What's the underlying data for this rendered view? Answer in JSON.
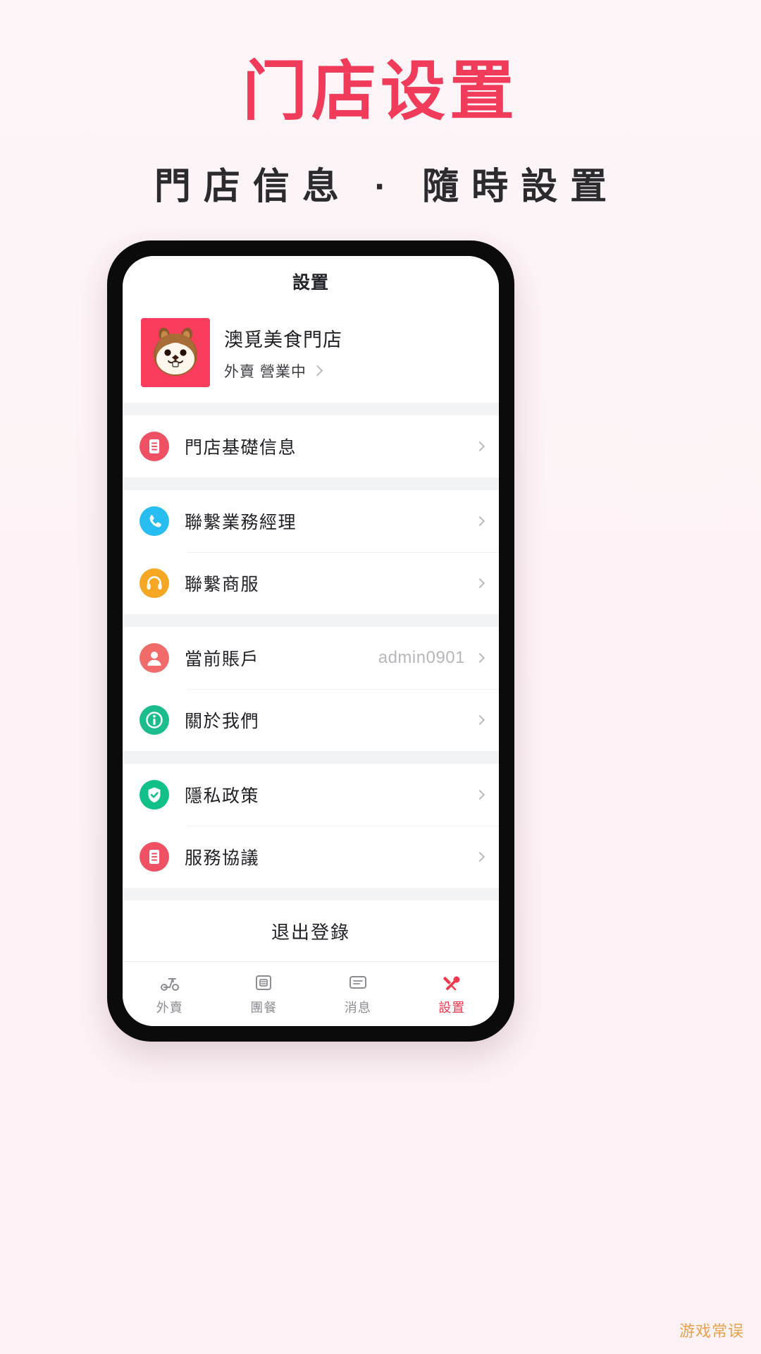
{
  "promo": {
    "title": "门店设置",
    "subtitle": "門店信息 · 隨時設置",
    "title_color": "#f03c5a"
  },
  "phone": {
    "appbar": {
      "title": "設置"
    },
    "store": {
      "name": "澳覓美食門店",
      "status": "外賣 營業中",
      "avatar_bg": "#fa3c5d",
      "chevron": "chevron-right-icon"
    },
    "groups": [
      {
        "items": [
          {
            "label": "門店基礎信息",
            "icon": "document-icon",
            "icon_color": "#f05064",
            "value": ""
          }
        ]
      },
      {
        "items": [
          {
            "label": "聯繫業務經理",
            "icon": "phone-icon",
            "icon_color": "#27bdf0",
            "value": ""
          },
          {
            "label": "聯繫商服",
            "icon": "headset-icon",
            "icon_color": "#f5a623",
            "value": ""
          }
        ]
      },
      {
        "items": [
          {
            "label": "當前賬戶",
            "icon": "user-icon",
            "icon_color": "#f26b6b",
            "value": "admin0901"
          },
          {
            "label": "關於我們",
            "icon": "info-icon",
            "icon_color": "#1bbd8e",
            "value": ""
          }
        ]
      },
      {
        "items": [
          {
            "label": "隱私政策",
            "icon": "shield-check-icon",
            "icon_color": "#12c08a",
            "value": ""
          },
          {
            "label": "服務協議",
            "icon": "document-icon",
            "icon_color": "#f05064",
            "value": ""
          }
        ]
      }
    ],
    "logout": {
      "label": "退出登錄"
    },
    "tabs": [
      {
        "label": "外賣",
        "icon": "scooter-icon",
        "active": false
      },
      {
        "label": "團餐",
        "icon": "meal-box-icon",
        "active": false
      },
      {
        "label": "消息",
        "icon": "message-icon",
        "active": false
      },
      {
        "label": "設置",
        "icon": "tools-icon",
        "active": true
      }
    ],
    "tab_active_color": "#f0384f"
  },
  "watermark": {
    "text": "游戏常误"
  }
}
